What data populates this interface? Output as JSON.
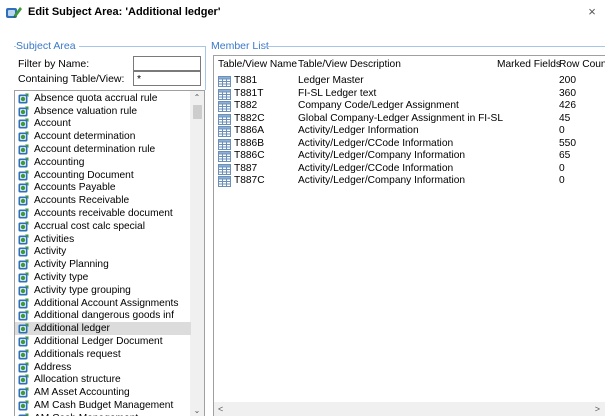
{
  "window": {
    "title": "Edit Subject Area: 'Additional ledger'",
    "close_glyph": "×"
  },
  "subject_area": {
    "group_label": "Subject Area",
    "filter_label": "Filter by Name:",
    "filter_value": "",
    "containing_label": "Containing Table/View:",
    "containing_value": "*",
    "items": [
      {
        "label": "Absence quota accrual rule",
        "icon": "subject-area-icon"
      },
      {
        "label": "Absence valuation rule",
        "icon": "subject-area-icon"
      },
      {
        "label": "Account",
        "icon": "subject-area-icon"
      },
      {
        "label": "Account determination",
        "icon": "subject-area-icon"
      },
      {
        "label": "Account determination rule",
        "icon": "subject-area-icon"
      },
      {
        "label": "Accounting",
        "icon": "subject-area-icon"
      },
      {
        "label": "Accounting Document",
        "icon": "subject-area-icon"
      },
      {
        "label": "Accounts Payable",
        "icon": "subject-area-icon"
      },
      {
        "label": "Accounts Receivable",
        "icon": "subject-area-icon"
      },
      {
        "label": "Accounts receivable document",
        "icon": "subject-area-icon"
      },
      {
        "label": "Accrual cost calc special",
        "icon": "subject-area-icon"
      },
      {
        "label": "Activities",
        "icon": "subject-area-icon"
      },
      {
        "label": "Activity",
        "icon": "subject-area-icon"
      },
      {
        "label": "Activity Planning",
        "icon": "subject-area-icon"
      },
      {
        "label": "Activity type",
        "icon": "subject-area-icon"
      },
      {
        "label": "Activity type grouping",
        "icon": "subject-area-icon"
      },
      {
        "label": "Additional Account Assignments",
        "icon": "subject-area-icon"
      },
      {
        "label": "Additional dangerous goods inf",
        "icon": "subject-area-icon"
      },
      {
        "label": "Additional ledger",
        "icon": "subject-area-icon",
        "selected": true
      },
      {
        "label": "Additional Ledger Document",
        "icon": "subject-area-icon"
      },
      {
        "label": "Additionals request",
        "icon": "subject-area-icon"
      },
      {
        "label": "Address",
        "icon": "subject-area-icon"
      },
      {
        "label": "Allocation structure",
        "icon": "subject-area-icon"
      },
      {
        "label": "AM Asset Accounting",
        "icon": "subject-area-icon"
      },
      {
        "label": "AM Cash Budget Management",
        "icon": "subject-area-icon"
      },
      {
        "label": "AM Cash Management",
        "icon": "subject-area-icon"
      }
    ],
    "scroll_up_glyph": "⌃",
    "scroll_down_glyph": "⌄"
  },
  "member_list": {
    "group_label": "Member List",
    "columns": [
      "Table/View Name",
      "Table/View Description",
      "Marked Fields",
      "Row Count"
    ],
    "rows": [
      {
        "name": "T881",
        "description": "Ledger Master",
        "marked": "",
        "count": "200"
      },
      {
        "name": "T881T",
        "description": "FI-SL Ledger text",
        "marked": "",
        "count": "360"
      },
      {
        "name": "T882",
        "description": "Company Code/Ledger Assignment",
        "marked": "",
        "count": "426"
      },
      {
        "name": "T882C",
        "description": "Global Company-Ledger Assignment in FI-SL",
        "marked": "",
        "count": "45"
      },
      {
        "name": "T886A",
        "description": "Activity/Ledger Information",
        "marked": "",
        "count": "0"
      },
      {
        "name": "T886B",
        "description": "Activity/Ledger/CCode Information",
        "marked": "",
        "count": "550"
      },
      {
        "name": "T886C",
        "description": "Activity/Ledger/Company Information",
        "marked": "",
        "count": "65"
      },
      {
        "name": "T887",
        "description": "Activity/Ledger/CCode Information",
        "marked": "",
        "count": "0"
      },
      {
        "name": "T887C",
        "description": "Activity/Ledger/Company Information",
        "marked": "",
        "count": "0"
      }
    ],
    "scroll_left_glyph": "<",
    "scroll_right_glyph": ">"
  },
  "colors": {
    "group_label": "#3a78c8",
    "selection": "#dcdcdc",
    "icon_green": "#3c9a3c",
    "icon_blue": "#2f6fb8"
  }
}
